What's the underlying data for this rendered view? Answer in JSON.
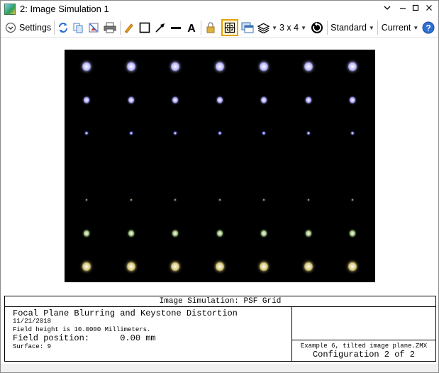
{
  "window": {
    "title": "2: Image Simulation 1",
    "minimize_glyph": "—",
    "restore_glyph": "▢",
    "maximize_glyph": "□",
    "close_glyph": "✕",
    "pin_glyph": "⌄"
  },
  "toolbar": {
    "settings_label": "Settings",
    "layout_label": "3 x 4",
    "standard_label": "Standard",
    "current_label": "Current",
    "icons": [
      "settings-toggle-icon",
      "refresh-icon",
      "copy-icon",
      "export-icon",
      "print-icon",
      "pencil-icon",
      "rectangle-icon",
      "arrow-icon",
      "line-icon",
      "text-icon",
      "lock-icon",
      "fit-icon",
      "window-icon",
      "layers-icon",
      "clock-icon",
      "help-icon"
    ]
  },
  "simulation": {
    "background": "#000000",
    "rows": [
      {
        "color": "#b9b7ff",
        "size": "large"
      },
      {
        "color": "#a9a3ff",
        "size": "medium"
      },
      {
        "color": "#7f86ff",
        "size": "small"
      },
      {
        "color": "#3f5a2a",
        "size": "tiny"
      },
      {
        "color": "#9fbf7a",
        "size": "medium"
      },
      {
        "color": "#d9c878",
        "size": "large"
      }
    ],
    "columns": 7
  },
  "info": {
    "header": "Image Simulation: PSF Grid",
    "title": "Focal Plane Blurring and Keystone Distortion",
    "date": "11/21/2018",
    "field_height": "Field height is 10.0000 Millimeters.",
    "field_position": "Field position:      0.00 mm",
    "surface": "Surface: 9",
    "file": "Example 6, tilted image plane.ZMX",
    "configuration": "Configuration 2 of 2"
  }
}
